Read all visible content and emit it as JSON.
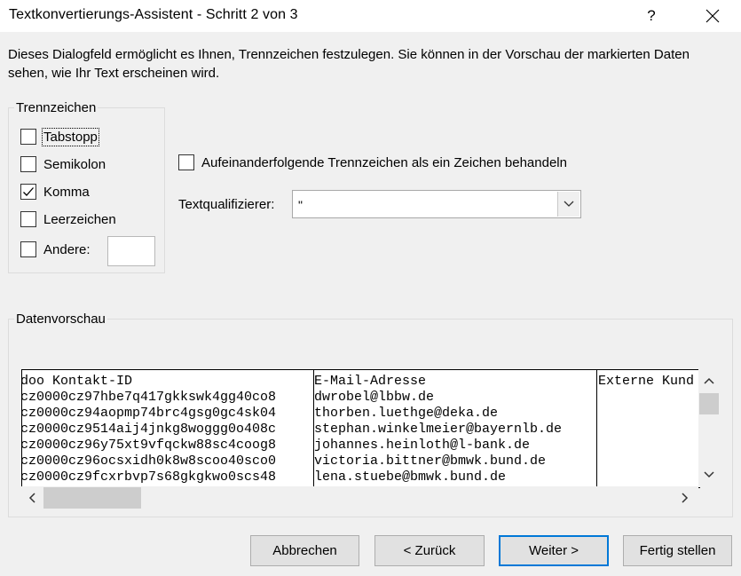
{
  "window": {
    "title": "Textkonvertierungs-Assistent - Schritt 2 von 3",
    "help_label": "?"
  },
  "intro_text": "Dieses Dialogfeld ermöglicht es Ihnen, Trennzeichen festzulegen. Sie können in der Vorschau der markierten Daten sehen, wie Ihr Text erscheinen wird.",
  "delimiters": {
    "group_label": "Trennzeichen",
    "items": [
      {
        "label": "Tabstopp",
        "checked": false
      },
      {
        "label": "Semikolon",
        "checked": false
      },
      {
        "label": "Komma",
        "checked": true
      },
      {
        "label": "Leerzeichen",
        "checked": false
      },
      {
        "label": "Andere:",
        "checked": false,
        "value": ""
      }
    ]
  },
  "consecutive": {
    "label": "Aufeinanderfolgende Trennzeichen als ein Zeichen behandeln",
    "checked": false
  },
  "qualifier": {
    "label": "Textqualifizierer:",
    "value": "\""
  },
  "preview": {
    "group_label": "Datenvorschau",
    "columns": [
      {
        "header": "doo Kontakt-ID",
        "rows": [
          "cz0000cz97hbe7q417gkkswk4gg40co8",
          "cz0000cz94aopmp74brc4gsg0gc4sk04",
          "cz0000cz9514aij4jnkg8woggg0o408c",
          "cz0000cz96y75xt9vfqckw88sc4coog8",
          "cz0000cz96ocsxidh0k8w8scoo40sco0",
          "cz0000cz9fcxrbvp7s68gkgkwo0scs48"
        ]
      },
      {
        "header": "E-Mail-Adresse",
        "rows": [
          "dwrobel@lbbw.de",
          "thorben.luethge@deka.de",
          "stephan.winkelmeier@bayernlb.de",
          "johannes.heinloth@l-bank.de",
          "victoria.bittner@bmwk.bund.de",
          "lena.stuebe@bmwk.bund.de"
        ]
      },
      {
        "header": "Externe Kund",
        "rows": [
          "",
          "",
          "",
          "",
          "",
          ""
        ]
      }
    ]
  },
  "buttons": {
    "cancel": "Abbrechen",
    "back": "< Zurück",
    "next": "Weiter >",
    "finish": "Fertig stellen"
  },
  "colors": {
    "dialog_bg": "#f0f0f0",
    "primary_border": "#0078d7"
  }
}
